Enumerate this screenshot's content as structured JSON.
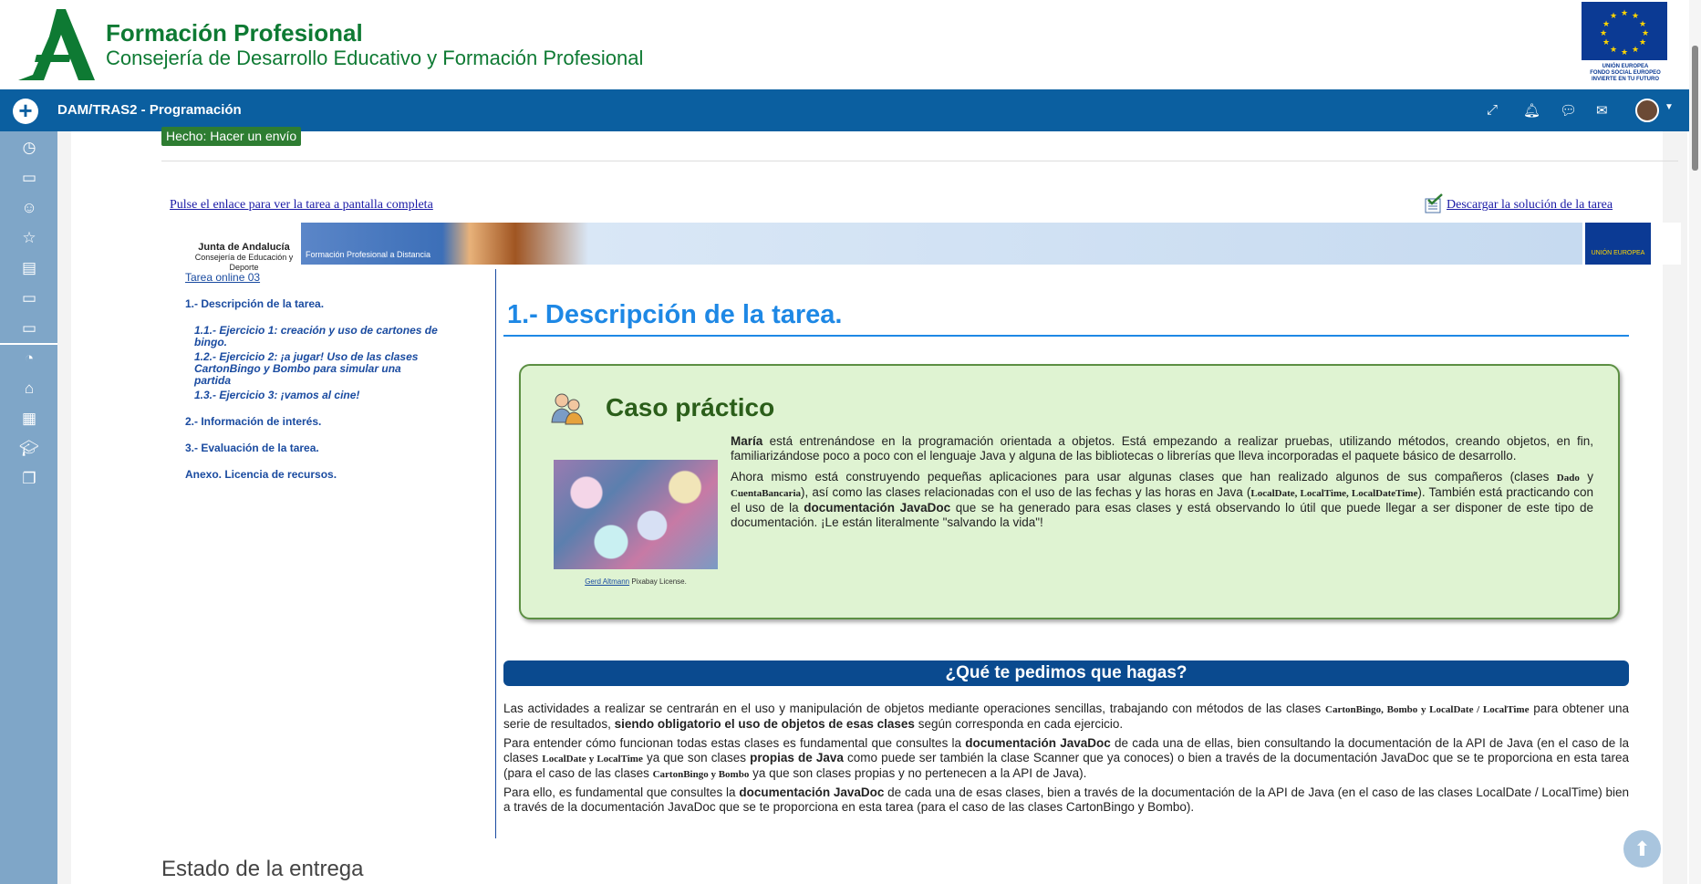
{
  "header": {
    "title": "Formación Profesional",
    "subtitle": "Consejería de Desarrollo Educativo y Formación Profesional",
    "eu_label": "UNIÓN EUROPEA\nFONDO SOCIAL EUROPEO\nINVIERTE EN TU FUTURO"
  },
  "navbar": {
    "course": "DAM/TRAS2 - Programación",
    "icons": [
      "expand-icon",
      "bell-icon",
      "chat-icon",
      "mail-icon"
    ]
  },
  "sidebar": {
    "icons": [
      "clock-icon",
      "folder-icon",
      "user-icon",
      "star-icon",
      "book-icon",
      "folder-icon",
      "folder-icon",
      "dashboard-icon",
      "home-icon",
      "calendar-icon",
      "graduation-icon",
      "copy-icon"
    ]
  },
  "main": {
    "status_badge": "Hecho: Hacer un envío",
    "link_fullscreen": "Pulse el enlace para ver la tarea a pantalla completa",
    "link_solution": "Descargar la solución de la tarea",
    "status_heading": "Estado de la entrega"
  },
  "frame": {
    "banner": {
      "ja_name": "Junta de Andalucía",
      "ja_sub": "Consejería de Educación y Deporte",
      "fpd": "Formación Profesional a Distancia",
      "eu": "UNIÓN EUROPEA"
    },
    "toc": {
      "title": "Tarea online 03",
      "items": [
        "1.- Descripción de la tarea.",
        "1.1.- Ejercicio 1: creación y uso de cartones de bingo.",
        "1.2.- Ejercicio 2: ¡a jugar! Uso de las clases CartonBingo y Bombo para simular una partida",
        "1.3.- Ejercicio 3: ¡vamos al cine!",
        "2.- Información de interés.",
        "3.- Evaluación de la tarea.",
        "Anexo. Licencia de recursos."
      ]
    },
    "heading": "1.- Descripción de la tarea.",
    "caso": {
      "title": "Caso práctico",
      "credit_author": "Gerd Altmann",
      "credit_license": " Pixabay License.",
      "p1_name": "María",
      "p1_rest": " está entrenándose en la programación orientada a objetos. Está empezando a realizar pruebas, utilizando métodos, creando objetos, en fin, familiarizándose poco a poco con el lenguaje Java y alguna de las bibliotecas o librerías que lleva incorporadas el paquete básico de desarrollo.",
      "p2_a": "Ahora mismo está construyendo pequeñas aplicaciones para usar algunas clases que han realizado algunos de sus compañeros (clases ",
      "p2_dado": "Dado",
      "p2_y": " y ",
      "p2_cuenta": "CuentaBancaria",
      "p2_b": "), así como las clases relacionadas con el uso de las fechas y las horas en Java (",
      "p2_classes": "LocalDate, LocalTime, LocalDateTime",
      "p2_c": "). También está practicando con el uso de la ",
      "p2_bold": "documentación JavaDoc",
      "p2_d": " que se ha generado para esas clases y está observando lo útil que puede llegar a ser disponer de este tipo de documentación. ¡Le están literalmente \"salvando la vida\"!"
    },
    "pedimos": "¿Qué te pedimos que hagas?",
    "body": {
      "p1_a": "Las actividades a realizar se centrarán en el uso y manipulación de objetos mediante operaciones sencillas, trabajando con métodos de las clases ",
      "p1_cls": "CartonBingo, Bombo y LocalDate / LocalTime",
      "p1_b": " para obtener una serie de resultados, ",
      "p1_bold": "siendo obligatorio el uso de objetos de esas clases",
      "p1_c": " según corresponda en cada ejercicio.",
      "p2_a": "Para entender cómo funcionan todas estas clases es fundamental que consultes la ",
      "p2_bold1": "documentación JavaDoc",
      "p2_b": " de cada una de ellas, bien consultando la documentación de la API de Java (en el caso de la clases ",
      "p2_cls1": "LocalDate y LocalTime",
      "p2_c": " ya que son clases ",
      "p2_bold2": "propias de Java",
      "p2_d": " como puede ser también la clase Scanner que ya conoces) o bien a través de la documentación JavaDoc que se te proporciona en esta tarea (para el caso de las clases ",
      "p2_cls2": "CartonBingo y Bombo",
      "p2_e": " ya que son clases propias y no pertenecen a la API de Java).",
      "p3_a": "Para ello, es fundamental que consultes la ",
      "p3_bold": "documentación JavaDoc",
      "p3_b": " de cada una de esas clases, bien a través de la documentación de la API de Java (en el caso de las clases LocalDate / LocalTime) bien a través de la documentación JavaDoc que se te proporciona en esta tarea (para el caso de las clases CartonBingo y Bombo)."
    }
  },
  "colors": {
    "navbar": "#0b5fa0",
    "sidebar": "#7fa6c8",
    "brand": "#0e7a33",
    "accent": "#1e88e5"
  }
}
